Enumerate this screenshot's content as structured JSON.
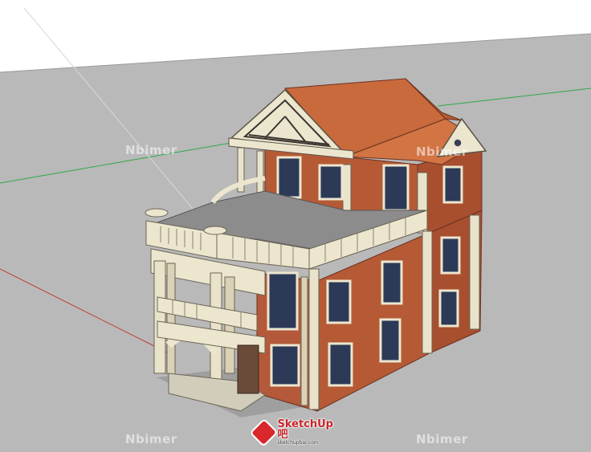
{
  "watermarks": [
    "Nbimer",
    "Nbimer",
    "Nbimer",
    "Nbimer"
  ],
  "logo": {
    "text": "SketchUp吧",
    "subtext": "sketchupbar.com"
  },
  "colors": {
    "background": "#b9b9b9",
    "sky": "#ffffff",
    "brick": "#b65a36",
    "roof": "#c96a3d",
    "trim": "#ece6cf",
    "terrace_floor": "#8c8c8c",
    "glass": "#2d3a57",
    "green_axis": "#2fa84a",
    "red_axis": "#c03a3a"
  }
}
